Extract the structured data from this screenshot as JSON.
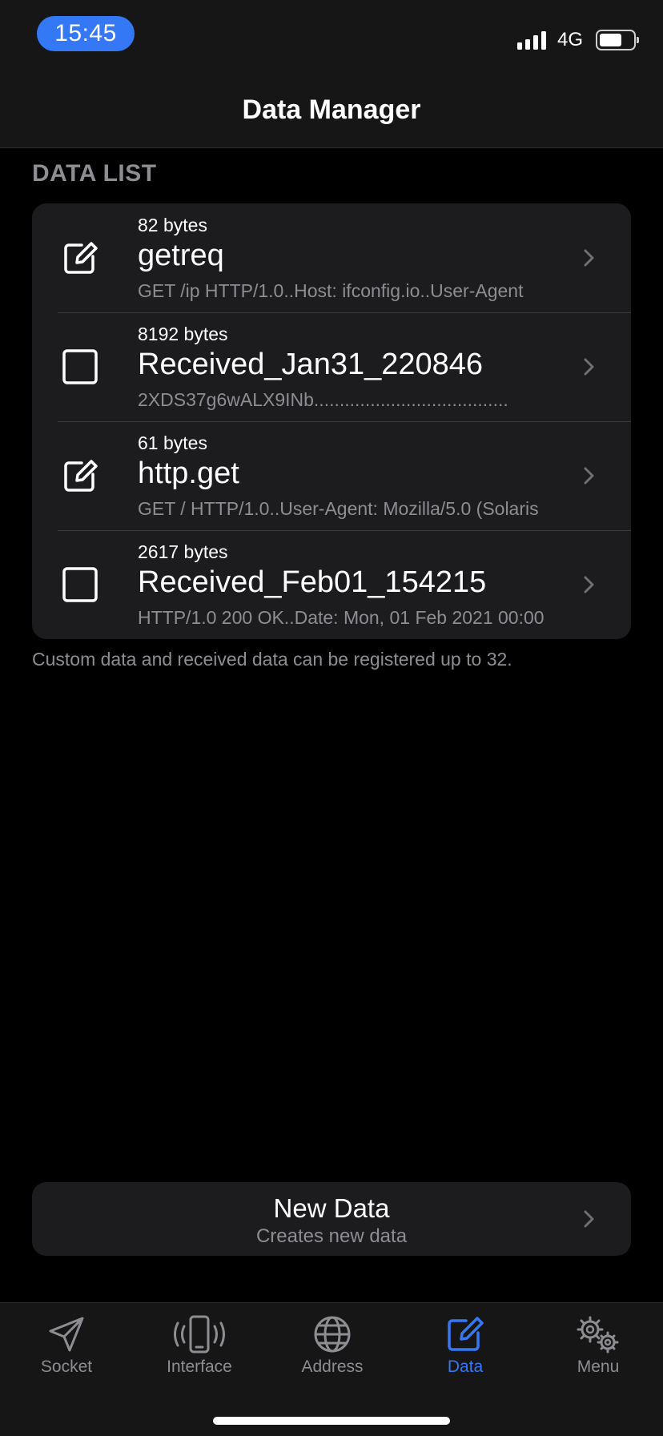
{
  "status_bar": {
    "time": "15:45",
    "network": "4G",
    "battery_level": 0.75
  },
  "nav": {
    "title": "Data Manager"
  },
  "section": {
    "header": "DATA LIST"
  },
  "items": [
    {
      "size": "82 bytes",
      "name": "getreq",
      "preview": "GET /ip HTTP/1.0..Host: ifconfig.io..User-Agent",
      "icon": "edit-icon"
    },
    {
      "size": "8192 bytes",
      "name": "Received_Jan31_220846",
      "preview": "2XDS37g6wALX9INb......................................",
      "icon": "checkbox-icon"
    },
    {
      "size": "61 bytes",
      "name": "http.get",
      "preview": "GET / HTTP/1.0..User-Agent: Mozilla/5.0 (Solaris",
      "icon": "edit-icon"
    },
    {
      "size": "2617 bytes",
      "name": "Received_Feb01_154215",
      "preview": "HTTP/1.0 200 OK..Date: Mon, 01 Feb 2021 00:00",
      "icon": "checkbox-icon"
    }
  ],
  "footer_note": "Custom data and received data can be registered up to 32.",
  "new_data": {
    "title": "New Data",
    "subtitle": "Creates new data"
  },
  "tabs": [
    {
      "label": "Socket",
      "icon": "send-icon"
    },
    {
      "label": "Interface",
      "icon": "phone-vibrate-icon"
    },
    {
      "label": "Address",
      "icon": "globe-icon"
    },
    {
      "label": "Data",
      "icon": "edit-icon",
      "active": true
    },
    {
      "label": "Menu",
      "icon": "gear-icon"
    }
  ],
  "colors": {
    "accent": "#3478f6",
    "background": "#000000",
    "cell": "#1c1c1e",
    "secondary_text": "#8d8d92"
  }
}
